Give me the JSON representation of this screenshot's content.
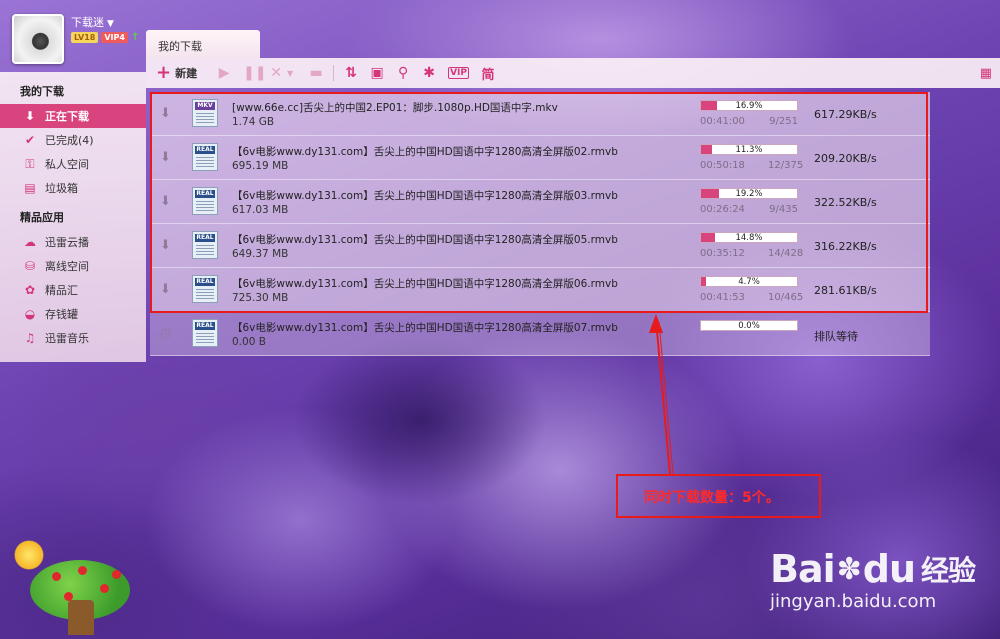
{
  "header": {
    "username": "下载迷",
    "level_badge": "LV18",
    "vip_badge": "VIP4",
    "tab_title": "我的下载"
  },
  "toolbar": {
    "new_label": "新建",
    "icons": [
      "play-icon",
      "pause-icon",
      "delete-icon",
      "dropdown-icon",
      "open-folder-icon",
      "sort-icon",
      "details-icon",
      "search-icon",
      "settings-icon",
      "vip-icon",
      "simplified-icon",
      "grid-view-icon"
    ],
    "vip_text": "VIP",
    "simplified_text": "简"
  },
  "sidebar": {
    "group1_title": "我的下载",
    "group1_items": [
      {
        "label": "正在下载",
        "icon": "download-icon",
        "active": true
      },
      {
        "label": "已完成(4)",
        "icon": "check-icon",
        "active": false
      },
      {
        "label": "私人空间",
        "icon": "lock-icon",
        "active": false
      },
      {
        "label": "垃圾箱",
        "icon": "trash-icon",
        "active": false
      }
    ],
    "group2_title": "精品应用",
    "group2_items": [
      {
        "label": "迅雷云播",
        "icon": "cloud-play-icon"
      },
      {
        "label": "离线空间",
        "icon": "offline-icon"
      },
      {
        "label": "精品汇",
        "icon": "gem-icon"
      },
      {
        "label": "存钱罐",
        "icon": "piggy-bank-icon"
      },
      {
        "label": "迅雷音乐",
        "icon": "music-icon"
      }
    ]
  },
  "downloads": [
    {
      "name": "[www.66e.cc]舌尖上的中国2.EP01：脚步.1080p.HD国语中字.mkv",
      "size": "1.74 GB",
      "type": "MKV",
      "progress": 16.9,
      "percent_text": "16.9%",
      "time": "00:41:00",
      "pieces": "9/251",
      "speed": "617.29KB/s",
      "state": "downloading"
    },
    {
      "name": "【6v电影www.dy131.com】舌尖上的中国HD国语中字1280高清全屏版02.rmvb",
      "size": "695.19 MB",
      "type": "REAL",
      "progress": 11.3,
      "percent_text": "11.3%",
      "time": "00:50:18",
      "pieces": "12/375",
      "speed": "209.20KB/s",
      "state": "downloading"
    },
    {
      "name": "【6v电影www.dy131.com】舌尖上的中国HD国语中字1280高清全屏版03.rmvb",
      "size": "617.03 MB",
      "type": "REAL",
      "progress": 19.2,
      "percent_text": "19.2%",
      "time": "00:26:24",
      "pieces": "9/435",
      "speed": "322.52KB/s",
      "state": "downloading"
    },
    {
      "name": "【6v电影www.dy131.com】舌尖上的中国HD国语中字1280高清全屏版05.rmvb",
      "size": "649.37 MB",
      "type": "REAL",
      "progress": 14.8,
      "percent_text": "14.8%",
      "time": "00:35:12",
      "pieces": "14/428",
      "speed": "316.22KB/s",
      "state": "downloading"
    },
    {
      "name": "【6v电影www.dy131.com】舌尖上的中国HD国语中字1280高清全屏版06.rmvb",
      "size": "725.30 MB",
      "type": "REAL",
      "progress": 4.7,
      "percent_text": "4.7%",
      "time": "00:41:53",
      "pieces": "10/465",
      "speed": "281.61KB/s",
      "state": "downloading"
    },
    {
      "name": "【6v电影www.dy131.com】舌尖上的中国HD国语中字1280高清全屏版07.rmvb",
      "size": "0.00 B",
      "type": "REAL",
      "progress": 0,
      "percent_text": "0.0%",
      "time": "",
      "pieces": "",
      "speed": "排队等待",
      "state": "queued"
    }
  ],
  "annotation": {
    "callout_text": "同时下载数量：5个。",
    "color": "#e81a1a"
  },
  "watermark": {
    "logo_text": "Bai",
    "logo_text2": "du",
    "logo_cn": "经验",
    "url": "jingyan.baidu.com"
  },
  "colors": {
    "accent": "#d9437e",
    "annotation": "#e81a1a"
  }
}
